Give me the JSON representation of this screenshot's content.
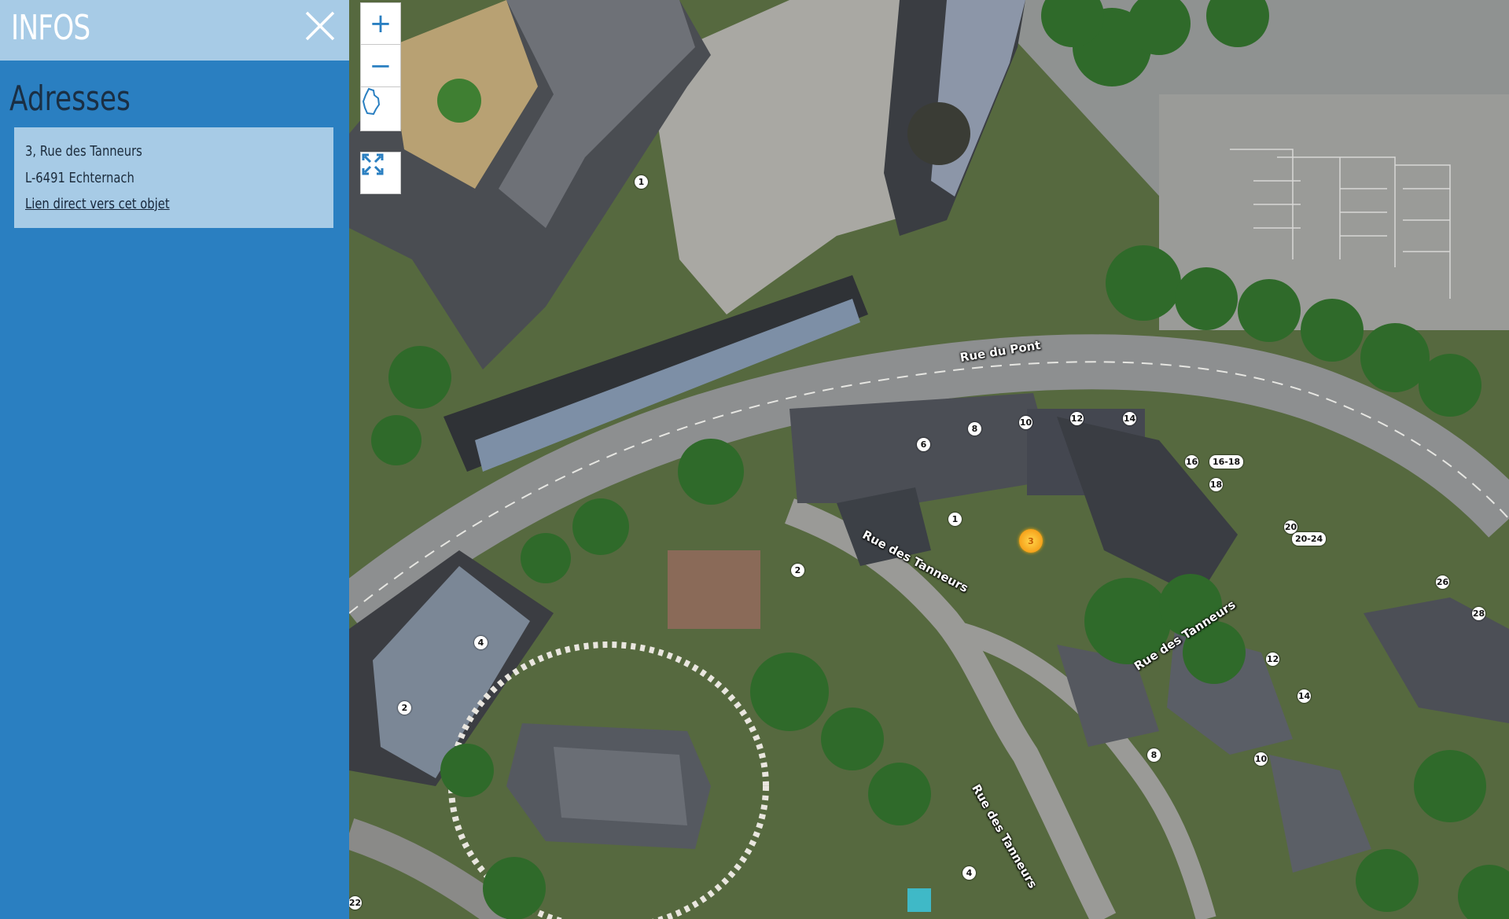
{
  "panel": {
    "title": "INFOS",
    "section_title": "Adresses",
    "address": {
      "street": "3, Rue des Tanneurs",
      "city": "L-6491 Echternach",
      "link_label": "Lien direct vers cet objet"
    }
  },
  "map_controls": {
    "zoom_in": "+",
    "zoom_out": "−",
    "country_icon": "luxembourg-outline-icon",
    "fullscreen_icon": "fullscreen-icon"
  },
  "streets": {
    "rue_du_pont": "Rue du Pont",
    "rue_des_tanneurs_1": "Rue des Tanneurs",
    "rue_des_tanneurs_2": "Rue des Tanneurs",
    "rue_des_tanneurs_3": "Rue des Tanneurs"
  },
  "house_numbers": [
    "1",
    "6",
    "8",
    "10",
    "12",
    "14",
    "16",
    "16-18",
    "18",
    "20",
    "20-24",
    "26",
    "28",
    "2",
    "4",
    "2",
    "1",
    "12",
    "14",
    "8",
    "10",
    "4",
    "22",
    "3"
  ],
  "selected_marker_label": "3",
  "colors": {
    "panel": "#2a7fc1",
    "panel_header": "#a7cbe6",
    "card": "#a7cbe6",
    "marker": "#f6a21b"
  }
}
